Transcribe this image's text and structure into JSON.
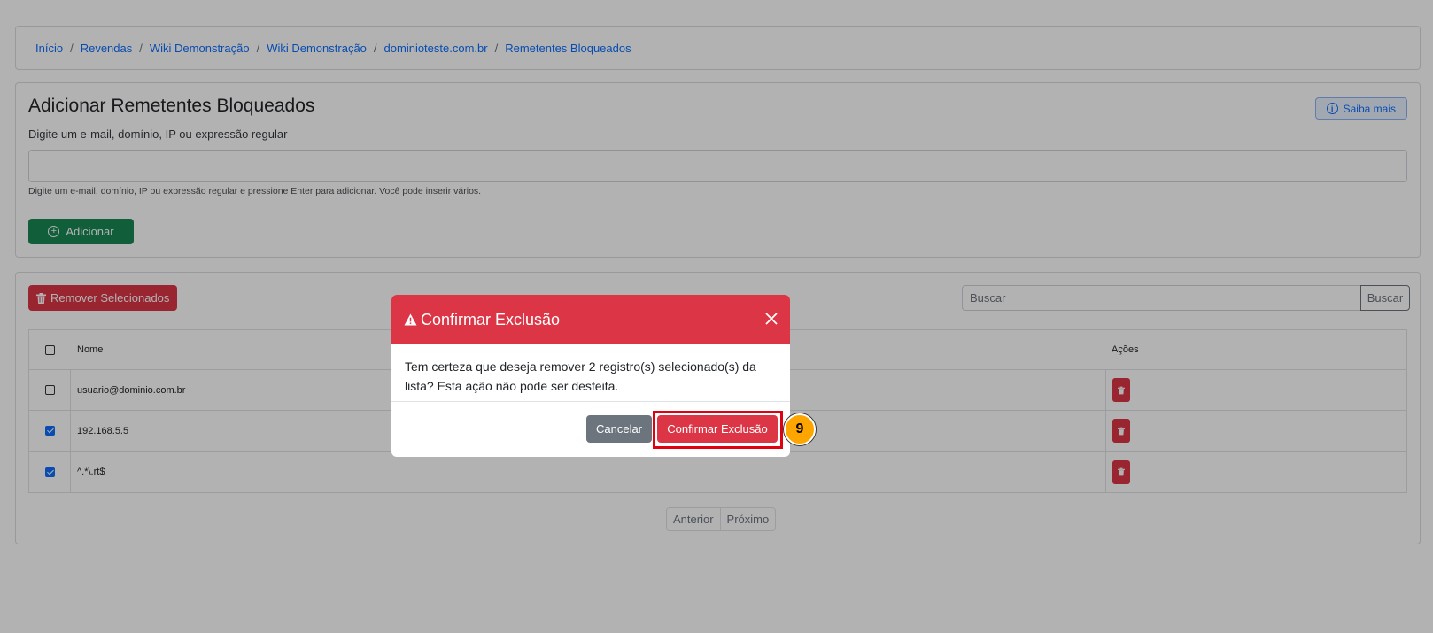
{
  "breadcrumb": {
    "items": [
      "Início",
      "Revendas",
      "Wiki Demonstração",
      "Wiki Demonstração",
      "dominioteste.com.br",
      "Remetentes Bloqueados"
    ],
    "separator": "/"
  },
  "add_section": {
    "title": "Adicionar Remetentes Bloqueados",
    "subtitle": "Digite um e-mail, domínio, IP ou expressão regular",
    "saiba_mais": "Saiba mais",
    "input_value": "",
    "help": "Digite um e-mail, domínio, IP ou expressão regular e pressione Enter para adicionar. Você pode inserir vários.",
    "add_button": "Adicionar"
  },
  "list_section": {
    "remove_selected": "Remover Selecionados",
    "search_placeholder": "Buscar",
    "search_button": "Buscar",
    "columns": {
      "name": "Nome",
      "actions": "Ações"
    },
    "rows": [
      {
        "name": "usuario@dominio.com.br",
        "checked": false
      },
      {
        "name": "192.168.5.5",
        "checked": true
      },
      {
        "name": "^.*\\.rt$",
        "checked": true
      }
    ],
    "pager": {
      "prev": "Anterior",
      "next": "Próximo"
    }
  },
  "modal": {
    "title": "Confirmar Exclusão",
    "body": "Tem certeza que deseja remover 2 registro(s) selecionado(s) da lista? Esta ação não pode ser desfeita.",
    "cancel": "Cancelar",
    "confirm": "Confirmar Exclusão"
  },
  "annotation": {
    "step": "9"
  },
  "colors": {
    "primary": "#0d6efd",
    "success": "#198754",
    "danger": "#dc3545",
    "secondary": "#6c757d",
    "step_badge": "#ffa500",
    "highlight": "#e0000f"
  }
}
